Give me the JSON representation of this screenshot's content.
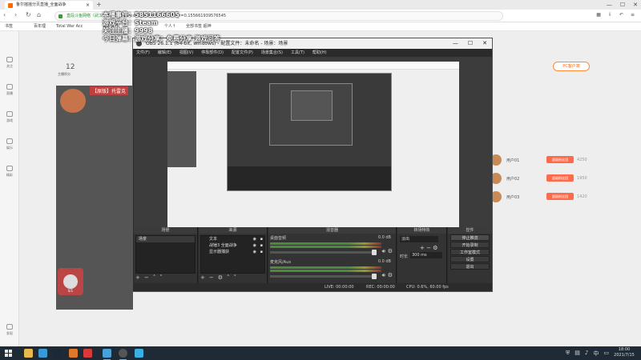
{
  "browser": {
    "tab_title": "鲁尔摇摇分页直播_全面战争",
    "url_prefix": "直段斗鱼网络（武汉）",
    "url": "https://www.douyu.com/37979467_r=0.155661939576545",
    "bookmarks": [
      "书签",
      "百年理",
      "Total War Acc",
      "百年世界",
      "个人↑",
      "全部书签 超神"
    ]
  },
  "sidebar": [
    "关注",
    "直播",
    "游戏",
    "娱乐",
    "精彩",
    "发现"
  ],
  "hud": {
    "line1": "本播事件：5851166605",
    "line2": "游戏平台：Steam",
    "line3": "关注主播：9998",
    "line4": "今日弹幕：游戏分享：免费分享  游戏问答"
  },
  "header": {
    "left_count": "12",
    "left_label": "主播积分",
    "right_btn": "PC客户端",
    "room_title": "【原版】托雷克"
  },
  "ranks": [
    {
      "name": "用户01",
      "btn": "超级粉丝团",
      "v": "4250"
    },
    {
      "name": "用户02",
      "btn": "超级粉丝团",
      "v": "1950"
    },
    {
      "name": "用户03",
      "btn": "超级粉丝团",
      "v": "1420"
    }
  ],
  "obs": {
    "title": "OBS 26.1.1 (64-bit, windows) - 配置文件：未命名 - 场景：场景",
    "menu": [
      "文件(F)",
      "编辑(E)",
      "视图(V)",
      "停靠部件(D)",
      "配置文件(P)",
      "场景集合(S)",
      "工具(T)",
      "帮助(H)"
    ],
    "docks": {
      "scenes": {
        "title": "场景",
        "items": [
          "场景"
        ]
      },
      "sources": {
        "title": "来源",
        "items": [
          "文本",
          "战锤3 全面战争",
          "显示器捕获"
        ]
      },
      "mixer": {
        "title": "混音器",
        "channels": [
          {
            "name": "桌面音频",
            "db": "0.0 dB"
          },
          {
            "name": "麦克风/Aux",
            "db": "0.0 dB"
          }
        ]
      },
      "transitions": {
        "title": "转场特效",
        "type": "淡出",
        "duration_label": "时长",
        "duration": "300 ms"
      },
      "controls": {
        "title": "控件",
        "buttons": [
          "停止推流",
          "开始录制",
          "工作室模式",
          "设置",
          "退出"
        ]
      }
    },
    "status": {
      "live": "LIVE: 00:00:00",
      "rec": "REC: 00:00:00",
      "cpu": "CPU: 0.6%, 60.00 fps"
    }
  },
  "live_badge": "0/1",
  "clock": {
    "time": "18:00",
    "date": "2021/7/15"
  }
}
